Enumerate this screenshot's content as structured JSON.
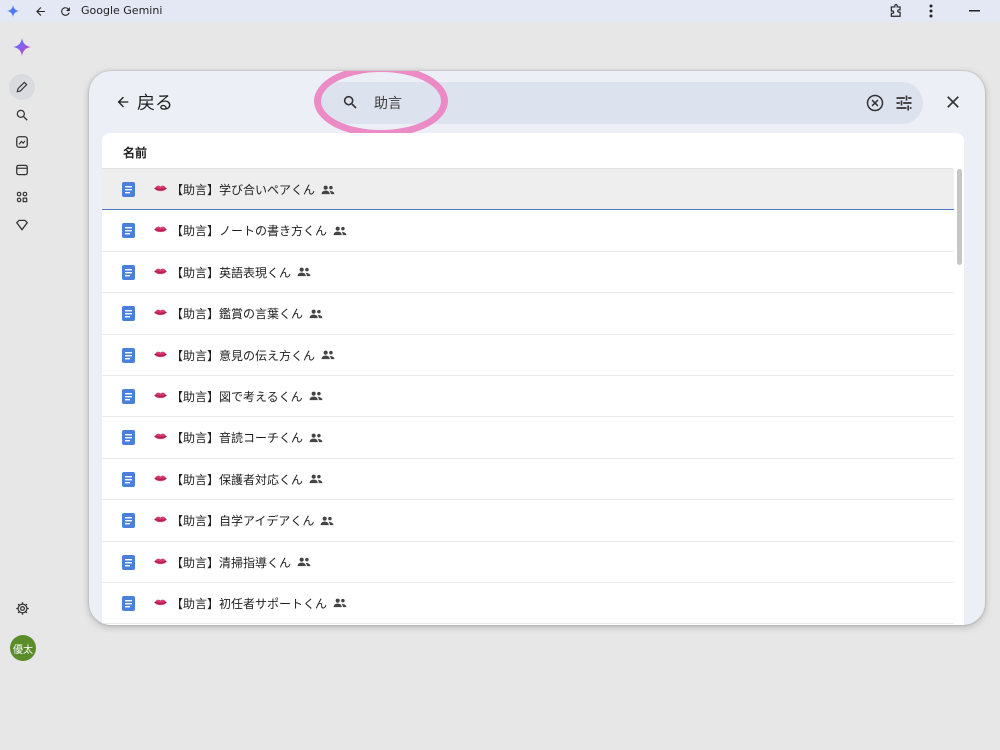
{
  "window": {
    "title": "Google Gemini"
  },
  "dialog": {
    "back_label": "戻る",
    "search": {
      "value": "助言"
    },
    "column_header": "名前",
    "rows": [
      {
        "label": "【助言】学び合いペアくん",
        "selected": true
      },
      {
        "label": "【助言】ノートの書き方くん"
      },
      {
        "label": "【助言】英語表現くん"
      },
      {
        "label": "【助言】鑑賞の言葉くん"
      },
      {
        "label": "【助言】意見の伝え方くん"
      },
      {
        "label": "【助言】図で考えるくん"
      },
      {
        "label": "【助言】音読コーチくん"
      },
      {
        "label": "【助言】保護者対応くん"
      },
      {
        "label": "【助言】自学アイデアくん"
      },
      {
        "label": "【助言】清掃指導くん"
      },
      {
        "label": "【助言】初任者サポートくん"
      }
    ],
    "scroll_position": 0
  },
  "user": {
    "avatar_label": "優太"
  },
  "colors": {
    "accent_blue": "#4a7bbf",
    "doc_icon": "#4a7fdb",
    "highlight_pink": "#ec80c0",
    "avatar_green": "#5b8c2a"
  },
  "icons": {
    "row_prefix": "lips-icon",
    "row_suffix": "shared-people-icon",
    "row_type": "document-icon"
  }
}
